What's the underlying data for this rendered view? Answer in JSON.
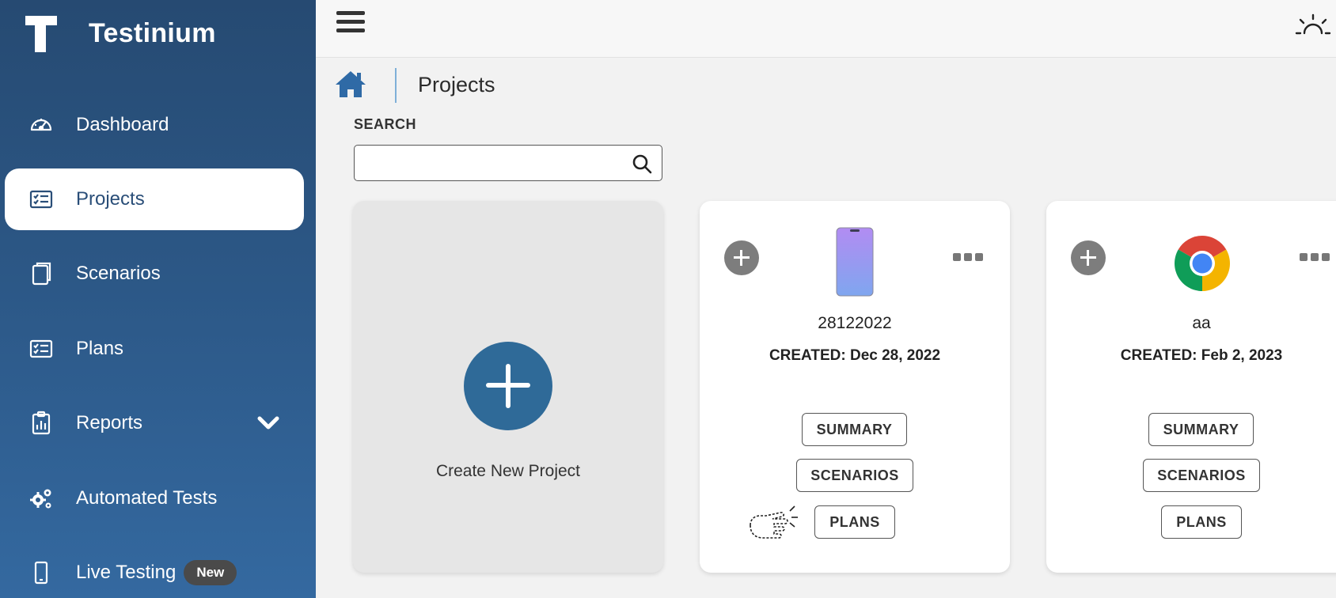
{
  "brand": {
    "name": "Testinium",
    "logo_letter": "T"
  },
  "sidebar": {
    "items": [
      {
        "label": "Dashboard",
        "icon": "gauge-icon"
      },
      {
        "label": "Projects",
        "icon": "list-card-icon",
        "active": true
      },
      {
        "label": "Scenarios",
        "icon": "pages-icon"
      },
      {
        "label": "Plans",
        "icon": "list-card-icon"
      },
      {
        "label": "Reports",
        "icon": "clipboard-chart-icon",
        "expandable": true
      },
      {
        "label": "Automated Tests",
        "icon": "gears-icon"
      },
      {
        "label": "Live Testing",
        "icon": "mobile-icon",
        "badge": "New"
      }
    ]
  },
  "breadcrumb": {
    "title": "Projects"
  },
  "search": {
    "label": "SEARCH",
    "value": "",
    "placeholder": ""
  },
  "create_card": {
    "label": "Create New Project"
  },
  "projects": [
    {
      "name": "28122022",
      "created": "CREATED: Dec 28, 2022",
      "platform_icon": "mobile-phone-icon",
      "buttons": {
        "summary": "SUMMARY",
        "scenarios": "SCENARIOS",
        "plans": "PLANS"
      }
    },
    {
      "name": "aa",
      "created": "CREATED: Feb 2, 2023",
      "platform_icon": "chrome-icon",
      "buttons": {
        "summary": "SUMMARY",
        "scenarios": "SCENARIOS",
        "plans": "PLANS"
      }
    }
  ],
  "colors": {
    "sidebar_top": "#264a72",
    "sidebar_bottom": "#3469a0",
    "accent": "#2f6a98",
    "active_text": "#2a4e78"
  }
}
